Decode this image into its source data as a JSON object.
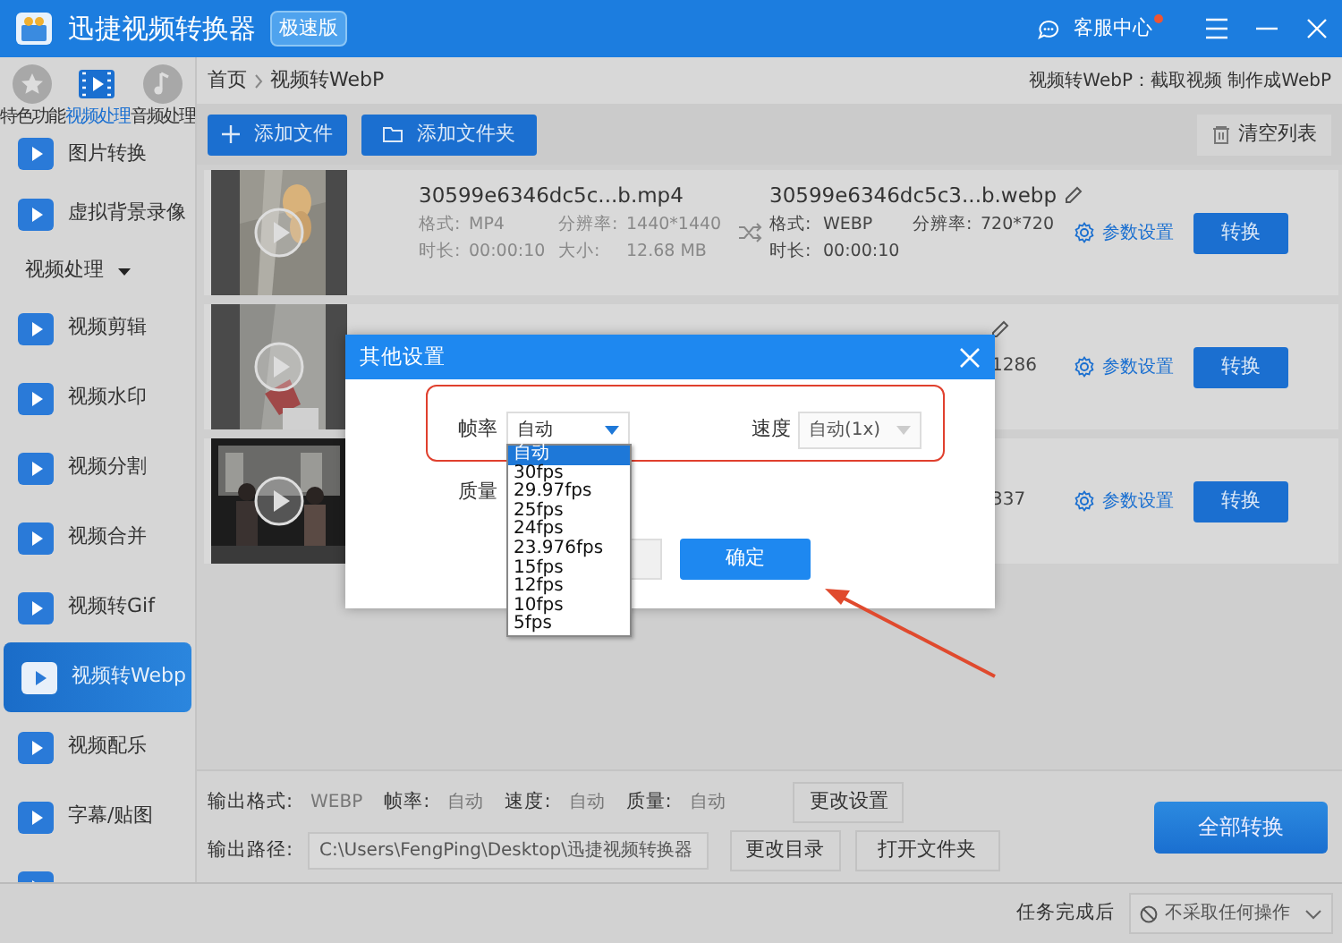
{
  "title_bar": {
    "app_name": "迅捷视频转换器",
    "edition": "极速版",
    "support": "客服中心",
    "support_unread": true
  },
  "sidebar": {
    "tabs": [
      {
        "label": "特色功能",
        "selected": false
      },
      {
        "label": "视频处理",
        "selected": true
      },
      {
        "label": "音频处理",
        "selected": false
      }
    ],
    "items": [
      {
        "kind": "item",
        "label": "图片转换",
        "selected": false
      },
      {
        "kind": "item",
        "label": "虚拟背景录像",
        "selected": false
      },
      {
        "kind": "group",
        "label": "视频处理",
        "expanded": true
      },
      {
        "kind": "item",
        "label": "视频剪辑",
        "selected": false
      },
      {
        "kind": "item",
        "label": "视频水印",
        "selected": false
      },
      {
        "kind": "item",
        "label": "视频分割",
        "selected": false
      },
      {
        "kind": "item",
        "label": "视频合并",
        "selected": false
      },
      {
        "kind": "item",
        "label": "视频转Gif",
        "selected": false
      },
      {
        "kind": "item",
        "label": "视频转Webp",
        "selected": true
      },
      {
        "kind": "item",
        "label": "视频配乐",
        "selected": false
      },
      {
        "kind": "item",
        "label": "字幕/贴图",
        "selected": false
      },
      {
        "kind": "item",
        "selected": false
      }
    ]
  },
  "breadcrumb": [
    "首页",
    "视频转WebP"
  ],
  "page_hint": "视频转WebP：截取视频 制作成WebP",
  "toolbar": {
    "add_file": "添加文件",
    "add_folder": "添加文件夹",
    "clear_list": "清空列表"
  },
  "files": [
    {
      "input_name": "30599e6346dc5c...b.mp4",
      "input_details": [
        {
          "label": "格式:",
          "value": "MP4"
        },
        {
          "label": "分辨率:",
          "value": "1440*1440"
        },
        {
          "label": "时长:",
          "value": "00:00:10"
        },
        {
          "label": "大小:",
          "value": "12.68 MB"
        }
      ],
      "output_name": "30599e6346dc5c3...b.webp",
      "editable": true,
      "output_details": [
        {
          "label": "格式:",
          "value": "WEBP"
        },
        {
          "label": "分辨率:",
          "value": "720*720"
        },
        {
          "label": "时长:",
          "value": "00:00:10"
        }
      ],
      "settings": "参数设置",
      "convert": "转换"
    },
    {
      "editable": true,
      "output_tail": "1286",
      "settings": "参数设置",
      "convert": "转换"
    },
    {
      "output_tail": "337",
      "settings": "参数设置",
      "convert": "转换"
    }
  ],
  "output": {
    "settings": [
      {
        "label": "输出格式:",
        "value": "WEBP"
      },
      {
        "label": "帧率:",
        "value": "自动"
      },
      {
        "label": "速度:",
        "value": "自动"
      },
      {
        "label": "质量:",
        "value": "自动"
      }
    ],
    "change_settings": "更改设置",
    "path_label": "输出路径:",
    "path": "C:\\Users\\FengPing\\Desktop\\迅捷视频转换器",
    "change_dir": "更改目录",
    "open_folder": "打开文件夹",
    "convert_all": "全部转换"
  },
  "status_bar": {
    "after_label": "任务完成后",
    "after_value": "不采取任何操作"
  },
  "dialog": {
    "title": "其他设置",
    "frame_rate": {
      "label": "帧率",
      "value": "自动",
      "expanded": true,
      "disabled": false,
      "options": [
        {
          "label": "自动",
          "selected": true
        },
        {
          "label": "30fps",
          "selected": false
        },
        {
          "label": "29.97fps",
          "selected": false
        },
        {
          "label": "25fps",
          "selected": false
        },
        {
          "label": "24fps",
          "selected": false
        },
        {
          "label": "23.976fps",
          "selected": false
        },
        {
          "label": "15fps",
          "selected": false
        },
        {
          "label": "12fps",
          "selected": false
        },
        {
          "label": "10fps",
          "selected": false
        },
        {
          "label": "5fps",
          "selected": false
        }
      ]
    },
    "speed": {
      "label": "速度",
      "value": "自动(1x)",
      "disabled": true
    },
    "quality_label": "质量",
    "confirm": "确定"
  }
}
